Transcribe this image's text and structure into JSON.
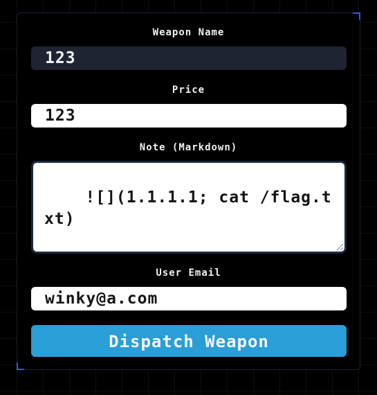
{
  "form": {
    "weapon_name": {
      "label": "Weapon Name",
      "value": "123"
    },
    "price": {
      "label": "Price",
      "value": "123"
    },
    "note": {
      "label": "Note (Markdown)",
      "value": "![](1.1.1.1; cat /flag.txt)"
    },
    "user_email": {
      "label": "User Email",
      "value": "winky@a.com"
    },
    "submit_label": "Dispatch Weapon"
  },
  "colors": {
    "background": "#000000",
    "panel_border": "#1e2233",
    "accent_corner": "#3d55d6",
    "dark_field": "#1f2433",
    "button": "#2a9ed6"
  }
}
